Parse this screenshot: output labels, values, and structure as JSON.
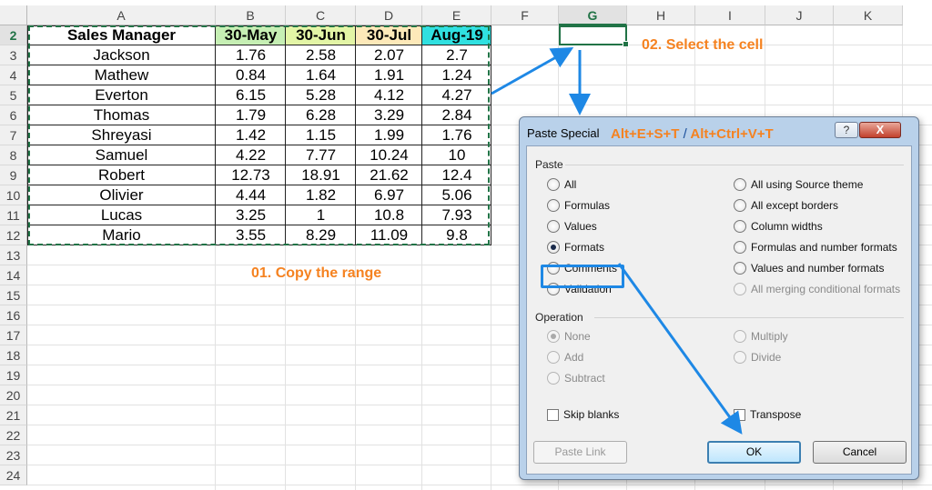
{
  "columns": [
    "A",
    "B",
    "C",
    "D",
    "E",
    "F",
    "G",
    "H",
    "I",
    "J",
    "K"
  ],
  "selected_column": "G",
  "rows": [
    "2",
    "3",
    "4",
    "5",
    "6",
    "7",
    "8",
    "9",
    "10",
    "11",
    "12",
    "13",
    "14",
    "15",
    "16",
    "17",
    "18",
    "19",
    "20",
    "21",
    "22",
    "23",
    "24"
  ],
  "selected_row": "2",
  "table": {
    "headers": [
      "Sales Manager",
      "30-May",
      "30-Jun",
      "30-Jul",
      "Aug-19"
    ],
    "header_colors": [
      "#ffffff",
      "#c6efb4",
      "#e3f5a6",
      "#fde9b9",
      "#30e0e0"
    ],
    "rows": [
      [
        "Jackson",
        "1.76",
        "2.58",
        "2.07",
        "2.7"
      ],
      [
        "Mathew",
        "0.84",
        "1.64",
        "1.91",
        "1.24"
      ],
      [
        "Everton",
        "6.15",
        "5.28",
        "4.12",
        "4.27"
      ],
      [
        "Thomas",
        "1.79",
        "6.28",
        "3.29",
        "2.84"
      ],
      [
        "Shreyasi",
        "1.42",
        "1.15",
        "1.99",
        "1.76"
      ],
      [
        "Samuel",
        "4.22",
        "7.77",
        "10.24",
        "10"
      ],
      [
        "Robert",
        "12.73",
        "18.91",
        "21.62",
        "12.4"
      ],
      [
        "Olivier",
        "4.44",
        "1.82",
        "6.97",
        "5.06"
      ],
      [
        "Lucas",
        "3.25",
        "1",
        "10.8",
        "7.93"
      ],
      [
        "Mario",
        "3.55",
        "8.29",
        "11.09",
        "9.8"
      ]
    ]
  },
  "annotations": {
    "step1": "01. Copy the range",
    "step2": "02. Select the cell",
    "accent_color": "#f58220",
    "arrow_color": "#1e88e5"
  },
  "dialog": {
    "title": "Paste Special",
    "shortcut_a": "Alt+E+S+T",
    "shortcut_sep": "/",
    "shortcut_b": "Alt+Ctrl+V+T",
    "help_label": "?",
    "close_label": "X",
    "paste_section": "Paste",
    "paste_left": [
      "All",
      "Formulas",
      "Values",
      "Formats",
      "Comments",
      "Validation"
    ],
    "paste_right": [
      "All using Source theme",
      "All except borders",
      "Column widths",
      "Formulas and number formats",
      "Values and number formats",
      "All merging conditional formats"
    ],
    "selected_paste": "Formats",
    "operation_section": "Operation",
    "operation_left": [
      "None",
      "Add",
      "Subtract"
    ],
    "operation_right": [
      "Multiply",
      "Divide"
    ],
    "skip_blanks": "Skip blanks",
    "transpose": "Transpose",
    "paste_link": "Paste Link",
    "ok": "OK",
    "cancel": "Cancel"
  }
}
